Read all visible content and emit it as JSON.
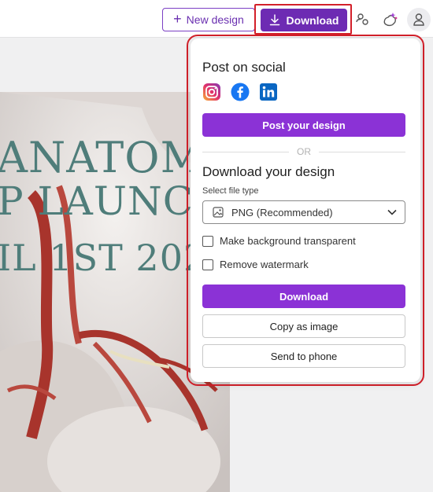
{
  "topbar": {
    "new_design_label": "New design",
    "download_label": "Download"
  },
  "canvas": {
    "line1": "ANATOMY",
    "line2": "P LAUNCH",
    "line3": "IL 1ST 202"
  },
  "panel": {
    "post_title": "Post on social",
    "social_icons": [
      "instagram-icon",
      "facebook-icon",
      "linkedin-icon"
    ],
    "post_button": "Post your design",
    "or_text": "OR",
    "download_title": "Download your design",
    "file_type_label": "Select file type",
    "file_type_value": "PNG (Recommended)",
    "option_transparent": "Make background transparent",
    "option_watermark": "Remove watermark",
    "download_button": "Download",
    "copy_button": "Copy as image",
    "phone_button": "Send to phone"
  },
  "colors": {
    "accent": "#8b32d6",
    "download_top": "#6d2bb3",
    "highlight": "#d3202a"
  }
}
